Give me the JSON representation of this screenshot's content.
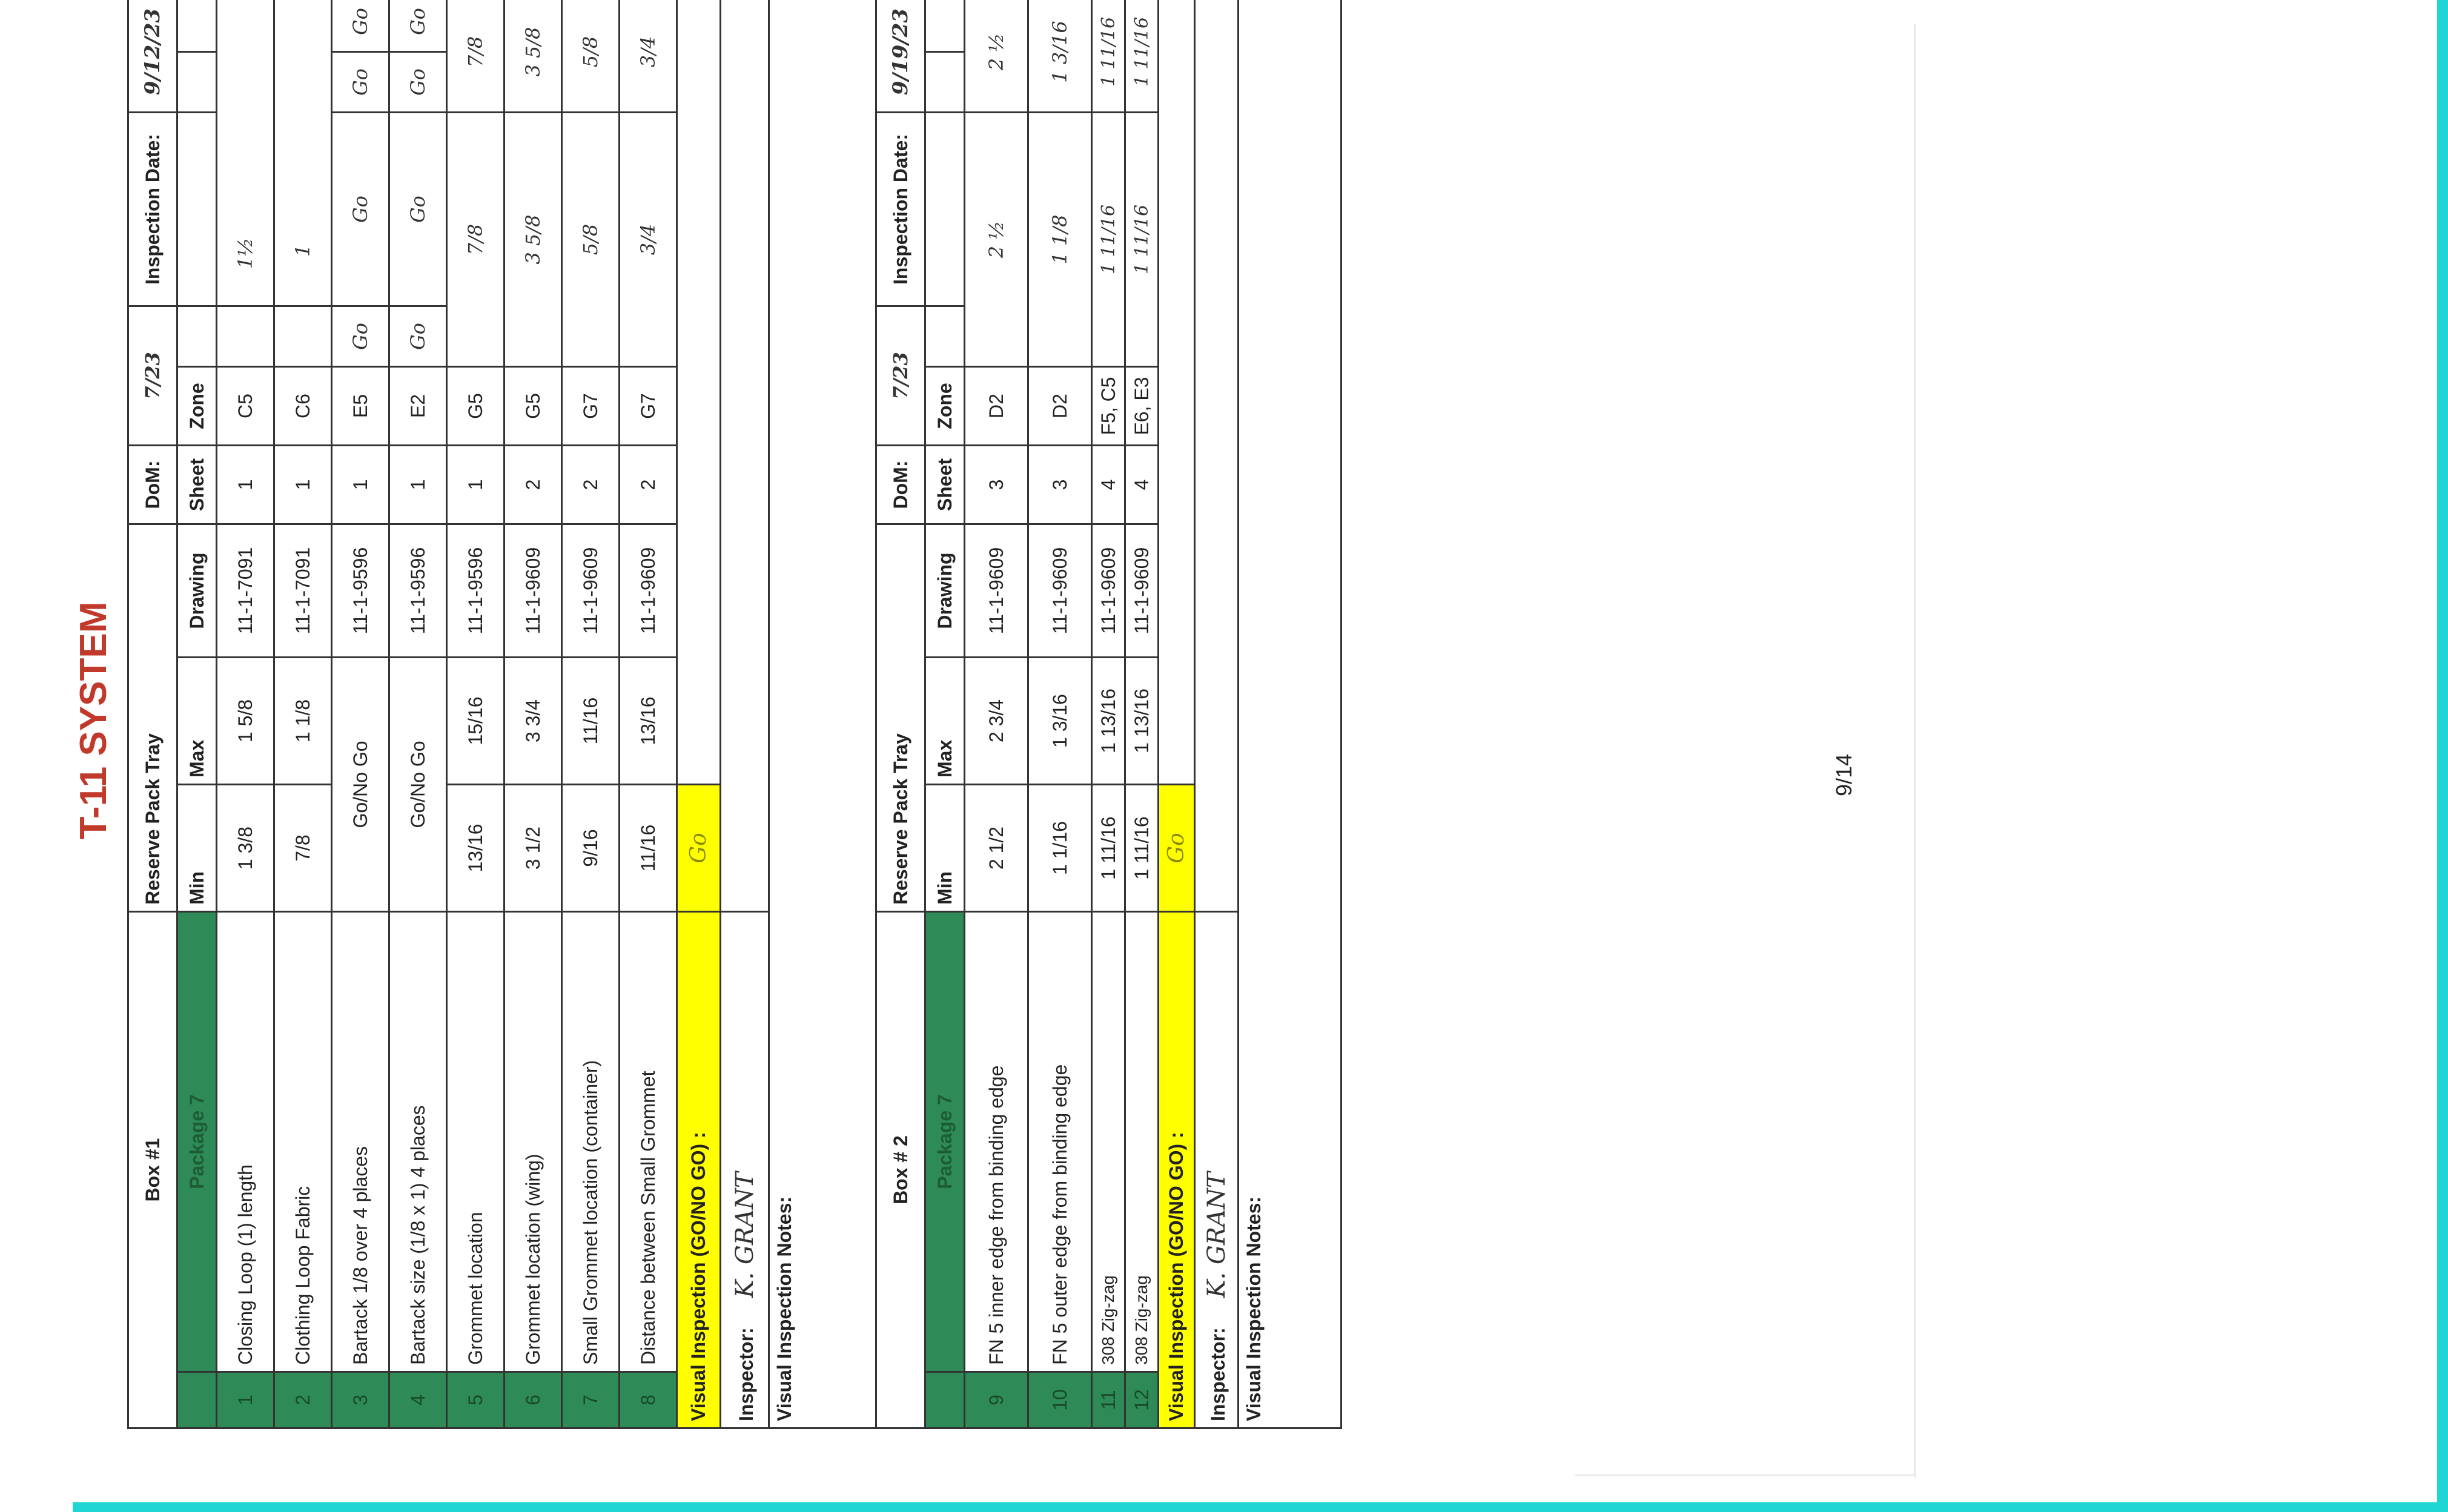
{
  "title": "T-11 SYSTEM",
  "page_number": "9/14",
  "column_headers": {
    "min": "Min",
    "max": "Max",
    "drawing": "Drawing",
    "sheet": "Sheet",
    "zone": "Zone"
  },
  "box1": {
    "name": "Box #1",
    "item": "Reserve Pack Tray",
    "dom_label": "DoM:",
    "dom_value": "7/23",
    "inspection_date_label": "Inspection Date:",
    "inspection_date_value": "9/12/23",
    "package": "Package 7",
    "rows": [
      {
        "num": "1",
        "desc": "Closing Loop (1) length",
        "min": "1  3/8",
        "max": "1  5/8",
        "drawing": "11-1-7091",
        "sheet": "1",
        "zone": "C5",
        "m1": "",
        "m2": "1½",
        "m3": "",
        "m4": ""
      },
      {
        "num": "2",
        "desc": "Clothing Loop Fabric",
        "min": "7/8",
        "max": "1  1/8",
        "drawing": "11-1-7091",
        "sheet": "1",
        "zone": "C6",
        "m1": "",
        "m2": "1",
        "m3": "",
        "m4": ""
      },
      {
        "num": "3",
        "desc": "Bartack 1/8 over  4 places",
        "min": "Go/No Go",
        "max": "",
        "drawing": "11-1-9596",
        "sheet": "1",
        "zone": "E5",
        "m1": "Go",
        "m2": "Go",
        "m3": "Go",
        "m4": "Go"
      },
      {
        "num": "4",
        "desc": "Bartack size (1/8 x 1) 4 places",
        "min": "Go/No Go",
        "max": "",
        "drawing": "11-1-9596",
        "sheet": "1",
        "zone": "E2",
        "m1": "Go",
        "m2": "Go",
        "m3": "Go",
        "m4": "Go"
      },
      {
        "num": "5",
        "desc": "Grommet location",
        "min": "13/16",
        "max": "15/16",
        "drawing": "11-1-9596",
        "sheet": "1",
        "zone": "G5",
        "m1": "",
        "m2": "7/8",
        "m3": "7/8",
        "m4": ""
      },
      {
        "num": "6",
        "desc": "Grommet location (wing)",
        "min": "3  1/2",
        "max": "3  3/4",
        "drawing": "11-1-9609",
        "sheet": "2",
        "zone": "G5",
        "m1": "",
        "m2": "3 5/8",
        "m3": "3 5/8",
        "m4": ""
      },
      {
        "num": "7",
        "desc": "Small Grommet location (container)",
        "min": "9/16",
        "max": "11/16",
        "drawing": "11-1-9609",
        "sheet": "2",
        "zone": "G7",
        "m1": "",
        "m2": "5/8",
        "m3": "5/8",
        "m4": ""
      },
      {
        "num": "8",
        "desc": "Distance between Small Grommet",
        "min": "11/16",
        "max": "13/16",
        "drawing": "11-1-9609",
        "sheet": "2",
        "zone": "G7",
        "m1": "",
        "m2": "3/4",
        "m3": "3/4",
        "m4": ""
      }
    ],
    "visual_label": "Visual Inspection (GO/NO GO) :",
    "visual_value": "Go",
    "inspector_label": "Inspector:",
    "inspector_value": "K. GRANT",
    "notes_label": "Visual Inspection Notes:"
  },
  "box2": {
    "name": "Box # 2",
    "item": "Reserve Pack Tray",
    "dom_label": "DoM:",
    "dom_value": "7/23",
    "inspection_date_label": "Inspection Date:",
    "inspection_date_value": "9/19/23",
    "package": "Package 7",
    "rows": [
      {
        "num": "9",
        "desc": "FN 5 inner edge from binding edge",
        "min": "2  1/2",
        "max": "2  3/4",
        "drawing": "11-1-9609",
        "sheet": "3",
        "zone": "D2",
        "m1": "",
        "m2": "2 ½",
        "m3": "2 ½",
        "m4": ""
      },
      {
        "num": "10",
        "desc": "FN 5 outer edge from binding edge",
        "min": "1  1/16",
        "max": "1  3/16",
        "drawing": "11-1-9609",
        "sheet": "3",
        "zone": "D2",
        "m1": "",
        "m2": "1 1/8",
        "m3": "1 3/16",
        "m4": ""
      },
      {
        "num": "11",
        "desc": "308 Zig-zag",
        "min": "1 11/16",
        "max": "1 13/16",
        "drawing": "11-1-9609",
        "sheet": "4",
        "zone": "F5, C5",
        "m1": "",
        "m2": "1 11/16",
        "m3": "1 11/16",
        "m4": ""
      },
      {
        "num": "12",
        "desc": "308 Zig-zag",
        "min": "1 11/16",
        "max": "1 13/16",
        "drawing": "11-1-9609",
        "sheet": "4",
        "zone": "E6, E3",
        "m1": "",
        "m2": "1 11/16",
        "m3": "1 11/16",
        "m4": ""
      }
    ],
    "visual_label": "Visual Inspection (GO/NO GO) :",
    "visual_value": "Go",
    "inspector_label": "Inspector:",
    "inspector_value": "K. GRANT",
    "notes_label": "Visual Inspection Notes:"
  },
  "colors": {
    "title": "#c0392b",
    "package_green": "#2e8b57",
    "highlight_yellow": "#ffff00",
    "scan_edge": "#1fd6d4"
  }
}
